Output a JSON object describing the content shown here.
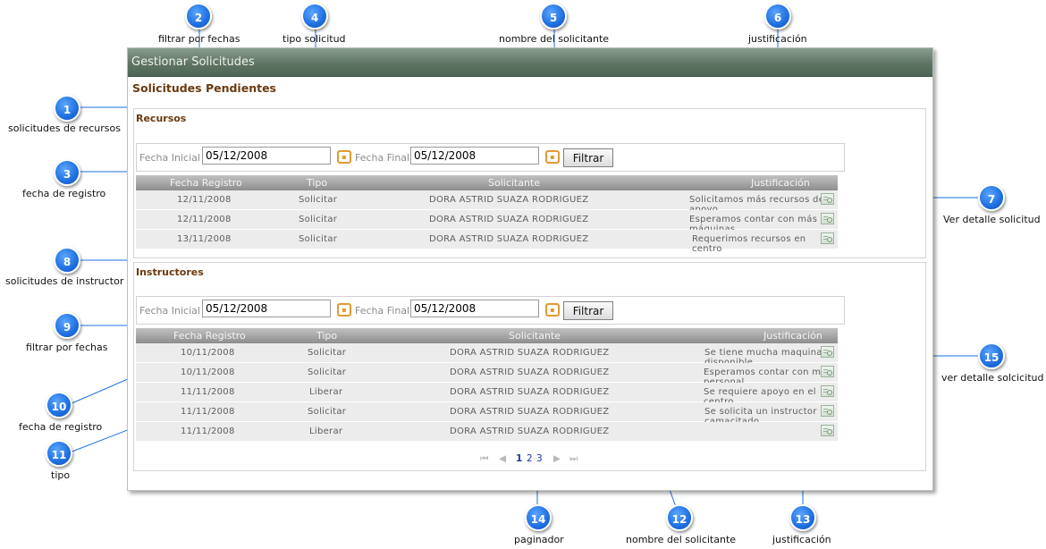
{
  "window": {
    "title": "Gestionar Solicitudes"
  },
  "page_title": "Solicitudes Pendientes",
  "recursos": {
    "title": "Recursos",
    "filter": {
      "label_start": "Fecha Inicial",
      "start_value": "05/12/2008",
      "label_end": "Fecha Final",
      "end_value": "05/12/2008",
      "button": "Filtrar"
    },
    "headers": [
      "Fecha Registro",
      "Tipo",
      "Solicitante",
      "Justificación"
    ],
    "rows": [
      [
        "12/11/2008",
        "Solicitar",
        "DORA ASTRID SUAZA RODRIGUEZ",
        "Solicitamos más recursos de apoyo"
      ],
      [
        "12/11/2008",
        "Solicitar",
        "DORA ASTRID SUAZA RODRIGUEZ",
        "Esperamos contar con más máquinas"
      ],
      [
        "13/11/2008",
        "Solicitar",
        "DORA ASTRID SUAZA RODRIGUEZ",
        "Requerimos recursos en centro"
      ]
    ]
  },
  "instructores": {
    "title": "Instructores",
    "filter": {
      "label_start": "Fecha Inicial",
      "start_value": "05/12/2008",
      "label_end": "Fecha Final",
      "end_value": "05/12/2008",
      "button": "Filtrar"
    },
    "headers": [
      "Fecha Registro",
      "Tipo",
      "Solicitante",
      "Justificación"
    ],
    "rows": [
      [
        "10/11/2008",
        "Solicitar",
        "DORA ASTRID SUAZA RODRIGUEZ",
        "Se tiene mucha maquinaria disponible"
      ],
      [
        "10/11/2008",
        "Solicitar",
        "DORA ASTRID SUAZA RODRIGUEZ",
        "Esperamos contar con más personal"
      ],
      [
        "11/11/2008",
        "Liberar",
        "DORA ASTRID SUAZA RODRIGUEZ",
        "Se requiere apoyo en el centro"
      ],
      [
        "11/11/2008",
        "Solicitar",
        "DORA ASTRID SUAZA RODRIGUEZ",
        "Se solicita un instructor camacitado"
      ],
      [
        "11/11/2008",
        "Liberar",
        "DORA ASTRID SUAZA RODRIGUEZ",
        ""
      ]
    ]
  },
  "pager": {
    "first": "⏮",
    "prev": "◀",
    "pages": [
      "1",
      "2",
      "3"
    ],
    "next": "▶",
    "last": "⏭"
  },
  "callouts": [
    {
      "n": "1",
      "label": "solicitudes de recursos"
    },
    {
      "n": "2",
      "label": "filtrar por fechas"
    },
    {
      "n": "3",
      "label": "fecha de registro"
    },
    {
      "n": "4",
      "label": "tipo solicitud"
    },
    {
      "n": "5",
      "label": "nombre del solicitante"
    },
    {
      "n": "6",
      "label": "justificación"
    },
    {
      "n": "7",
      "label": "Ver detalle solicitud"
    },
    {
      "n": "8",
      "label": "solicitudes de instructor"
    },
    {
      "n": "9",
      "label": "filtrar por fechas"
    },
    {
      "n": "10",
      "label": "fecha de registro"
    },
    {
      "n": "11",
      "label": "tipo"
    },
    {
      "n": "12",
      "label": "nombre del solicitante"
    },
    {
      "n": "13",
      "label": "justificación"
    },
    {
      "n": "14",
      "label": "paginador"
    },
    {
      "n": "15",
      "label": "ver detalle solcicitud"
    }
  ],
  "colors": {
    "marker": "#1f6fe0",
    "section_title": "#6b3a0f",
    "title_bar": "#5f7564"
  }
}
